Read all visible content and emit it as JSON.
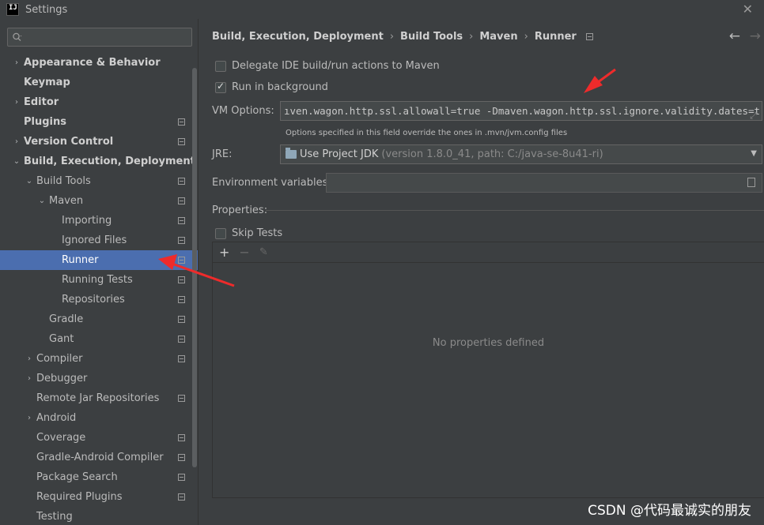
{
  "window": {
    "title": "Settings",
    "logo_text": "IJ",
    "close_glyph": "✕"
  },
  "sidebar": {
    "search_placeholder": "",
    "items": [
      {
        "label": "Appearance & Behavior",
        "bold": true,
        "chevron": "›",
        "indent": 0
      },
      {
        "label": "Keymap",
        "bold": true,
        "chevron": "",
        "indent": 0
      },
      {
        "label": "Editor",
        "bold": true,
        "chevron": "›",
        "indent": 0
      },
      {
        "label": "Plugins",
        "bold": true,
        "chevron": "",
        "indent": 0,
        "project_icon": true
      },
      {
        "label": "Version Control",
        "bold": true,
        "chevron": "›",
        "indent": 0,
        "project_icon": true
      },
      {
        "label": "Build, Execution, Deployment",
        "bold": true,
        "chevron": "⌄",
        "indent": 0
      },
      {
        "label": "Build Tools",
        "bold": false,
        "chevron": "⌄",
        "indent": 1,
        "project_icon": true
      },
      {
        "label": "Maven",
        "bold": false,
        "chevron": "⌄",
        "indent": 2,
        "project_icon": true
      },
      {
        "label": "Importing",
        "bold": false,
        "chevron": "",
        "indent": 3,
        "project_icon": true
      },
      {
        "label": "Ignored Files",
        "bold": false,
        "chevron": "",
        "indent": 3,
        "project_icon": true
      },
      {
        "label": "Runner",
        "bold": false,
        "chevron": "",
        "indent": 3,
        "project_icon": true,
        "selected": true
      },
      {
        "label": "Running Tests",
        "bold": false,
        "chevron": "",
        "indent": 3,
        "project_icon": true
      },
      {
        "label": "Repositories",
        "bold": false,
        "chevron": "",
        "indent": 3,
        "project_icon": true
      },
      {
        "label": "Gradle",
        "bold": false,
        "chevron": "",
        "indent": 2,
        "project_icon": true
      },
      {
        "label": "Gant",
        "bold": false,
        "chevron": "",
        "indent": 2,
        "project_icon": true
      },
      {
        "label": "Compiler",
        "bold": false,
        "chevron": "›",
        "indent": 1,
        "project_icon": true
      },
      {
        "label": "Debugger",
        "bold": false,
        "chevron": "›",
        "indent": 1
      },
      {
        "label": "Remote Jar Repositories",
        "bold": false,
        "chevron": "",
        "indent": 1,
        "project_icon": true
      },
      {
        "label": "Android",
        "bold": false,
        "chevron": "›",
        "indent": 1
      },
      {
        "label": "Coverage",
        "bold": false,
        "chevron": "",
        "indent": 1,
        "project_icon": true
      },
      {
        "label": "Gradle-Android Compiler",
        "bold": false,
        "chevron": "",
        "indent": 1,
        "project_icon": true
      },
      {
        "label": "Package Search",
        "bold": false,
        "chevron": "",
        "indent": 1,
        "project_icon": true
      },
      {
        "label": "Required Plugins",
        "bold": false,
        "chevron": "",
        "indent": 1,
        "project_icon": true
      },
      {
        "label": "Testing",
        "bold": false,
        "chevron": "",
        "indent": 1
      }
    ]
  },
  "breadcrumb": {
    "parts": [
      "Build, Execution, Deployment",
      "Build Tools",
      "Maven",
      "Runner"
    ],
    "separator": "›",
    "back_glyph": "←",
    "forward_glyph": "→"
  },
  "runner": {
    "delegate_label": "Delegate IDE build/run actions to Maven",
    "delegate_checked": false,
    "background_label": "Run in background",
    "background_checked": true,
    "vm_label": "VM Options:",
    "vm_value": "ıven.wagon.http.ssl.allowall=true -Dmaven.wagon.http.ssl.ignore.validity.dates=true",
    "vm_hint": "Options specified in this field override the ones in .mvn/jvm.config files",
    "jre_label": "JRE:",
    "jre_value": "Use Project JDK",
    "jre_detail": "(version 1.8.0_41, path: C:/java-se-8u41-ri)",
    "env_label": "Environment variables:",
    "env_value": "",
    "properties_label": "Properties:",
    "skip_tests_label": "Skip Tests",
    "skip_tests_checked": false,
    "empty_properties": "No properties defined",
    "add_glyph": "+",
    "remove_glyph": "−",
    "edit_glyph": "✎"
  },
  "watermark": "CSDN @代码最诚实的朋友",
  "colors": {
    "background": "#3c3f41",
    "selection": "#4b6eaf",
    "annotation_arrow": "#ee2b2b"
  }
}
